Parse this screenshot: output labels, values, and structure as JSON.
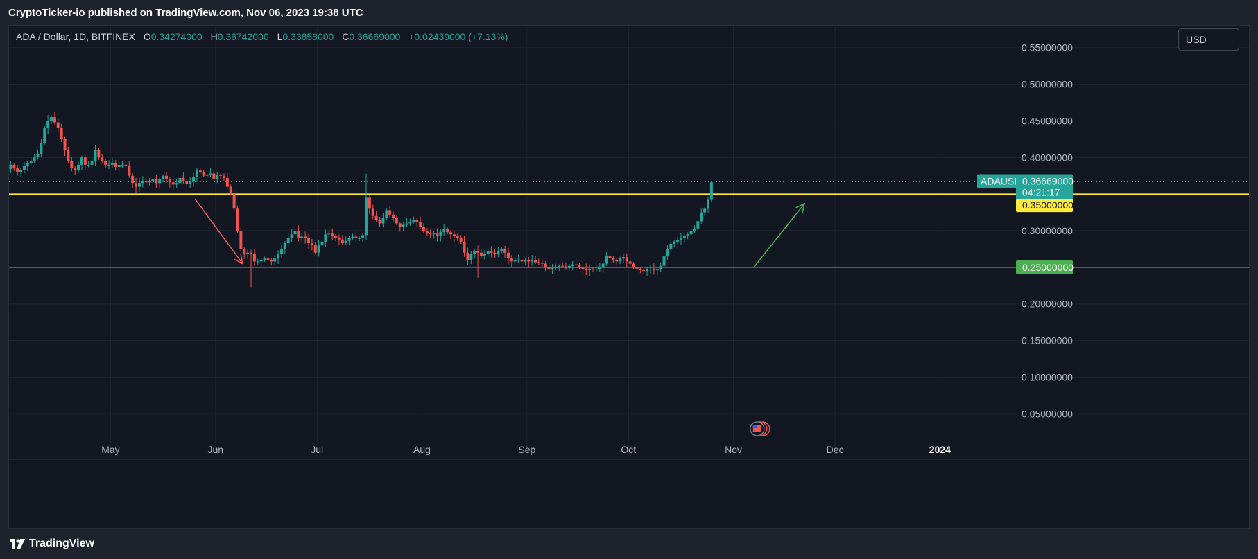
{
  "header": {
    "publisher": "CryptoTicker-io",
    "published_text": "published on TradingView.com, Nov 06, 2023 19:38 UTC"
  },
  "legend": {
    "symbol": "ADA / Dollar, 1D, BITFINEX",
    "open_label": "O",
    "open": "0.34274000",
    "high_label": "H",
    "high": "0.36742000",
    "low_label": "L",
    "low": "0.33858000",
    "close_label": "C",
    "close": "0.36669000",
    "change": "+0.02439000 (+7.13%)"
  },
  "currency_button": "USD",
  "footer": {
    "brand": "TradingView"
  },
  "colors": {
    "up": "#26a69a",
    "down": "#ef5350",
    "resistance": "#ffeb3b",
    "support": "#4caf50",
    "arrow_down": "#f05a5a",
    "arrow_up": "#4caf50"
  },
  "price_tags": {
    "symbol_tag": "ADAUSD",
    "last_price": "0.36669000",
    "countdown": "04:21:17",
    "resistance": "0.35000000",
    "support": "0.25000000"
  },
  "chart_data": {
    "type": "candlestick",
    "symbol": "ADAUSD",
    "timeframe": "1D",
    "exchange": "BITFINEX",
    "ylim": [
      0.02,
      0.58
    ],
    "y_ticks": [
      0.05,
      0.1,
      0.15,
      0.2,
      0.25,
      0.3,
      0.35,
      0.4,
      0.45,
      0.5,
      0.55
    ],
    "y_tick_labels": [
      "0.05000000",
      "0.10000000",
      "0.15000000",
      "0.20000000",
      "0.25000000",
      "0.30000000",
      "0.35000000",
      "0.40000000",
      "0.45000000",
      "0.50000000",
      "0.55000000"
    ],
    "x_start": "2023-04-01",
    "x_end": "2024-01-21",
    "x_ticks": [
      {
        "date": "2023-05-01",
        "label": "May"
      },
      {
        "date": "2023-06-01",
        "label": "Jun"
      },
      {
        "date": "2023-07-01",
        "label": "Jul"
      },
      {
        "date": "2023-08-01",
        "label": "Aug"
      },
      {
        "date": "2023-09-01",
        "label": "Sep"
      },
      {
        "date": "2023-10-01",
        "label": "Oct"
      },
      {
        "date": "2023-11-01",
        "label": "Nov"
      },
      {
        "date": "2023-12-01",
        "label": "Dec"
      },
      {
        "date": "2024-01-01",
        "label": "2024",
        "bold": true
      }
    ],
    "grid": true,
    "horizontal_lines": [
      {
        "value": 0.35,
        "color": "#ffeb3b",
        "name": "resistance"
      },
      {
        "value": 0.25,
        "color": "#4caf50",
        "name": "support"
      }
    ],
    "last_price": 0.36669,
    "arrows": [
      {
        "from": {
          "date": "2023-05-26",
          "value": 0.343
        },
        "to": {
          "date": "2023-06-09",
          "value": 0.255
        },
        "color": "#f05a5a"
      },
      {
        "from": {
          "date": "2023-11-07",
          "value": 0.25
        },
        "to": {
          "date": "2023-11-22",
          "value": 0.337
        },
        "color": "#4caf50"
      }
    ],
    "closes": [
      0.39,
      0.385,
      0.38,
      0.383,
      0.388,
      0.392,
      0.395,
      0.4,
      0.405,
      0.42,
      0.44,
      0.45,
      0.455,
      0.448,
      0.44,
      0.425,
      0.41,
      0.395,
      0.385,
      0.383,
      0.39,
      0.4,
      0.39,
      0.39,
      0.395,
      0.41,
      0.4,
      0.395,
      0.39,
      0.39,
      0.392,
      0.387,
      0.39,
      0.39,
      0.388,
      0.375,
      0.365,
      0.36,
      0.365,
      0.368,
      0.366,
      0.368,
      0.37,
      0.365,
      0.37,
      0.375,
      0.37,
      0.366,
      0.363,
      0.365,
      0.372,
      0.368,
      0.364,
      0.367,
      0.373,
      0.382,
      0.38,
      0.375,
      0.376,
      0.378,
      0.37,
      0.376,
      0.375,
      0.372,
      0.36,
      0.35,
      0.33,
      0.3,
      0.275,
      0.268,
      0.27,
      0.268,
      0.258,
      0.258,
      0.26,
      0.262,
      0.26,
      0.258,
      0.262,
      0.268,
      0.275,
      0.283,
      0.29,
      0.295,
      0.3,
      0.29,
      0.292,
      0.29,
      0.283,
      0.28,
      0.27,
      0.28,
      0.285,
      0.295,
      0.296,
      0.293,
      0.29,
      0.288,
      0.283,
      0.286,
      0.29,
      0.292,
      0.29,
      0.29,
      0.294,
      0.345,
      0.33,
      0.32,
      0.315,
      0.31,
      0.317,
      0.328,
      0.322,
      0.317,
      0.31,
      0.305,
      0.308,
      0.31,
      0.312,
      0.315,
      0.312,
      0.305,
      0.3,
      0.296,
      0.295,
      0.296,
      0.293,
      0.298,
      0.302,
      0.298,
      0.295,
      0.293,
      0.29,
      0.285,
      0.27,
      0.26,
      0.268,
      0.272,
      0.27,
      0.266,
      0.268,
      0.272,
      0.27,
      0.268,
      0.272,
      0.275,
      0.27,
      0.262,
      0.258,
      0.26,
      0.26,
      0.258,
      0.26,
      0.258,
      0.26,
      0.257,
      0.256,
      0.255,
      0.25,
      0.247,
      0.249,
      0.25,
      0.252,
      0.251,
      0.249,
      0.252,
      0.254,
      0.253,
      0.25,
      0.248,
      0.246,
      0.248,
      0.247,
      0.248,
      0.25,
      0.255,
      0.265,
      0.263,
      0.26,
      0.258,
      0.262,
      0.264,
      0.258,
      0.255,
      0.25,
      0.248,
      0.246,
      0.245,
      0.247,
      0.248,
      0.246,
      0.247,
      0.252,
      0.265,
      0.275,
      0.282,
      0.285,
      0.287,
      0.29,
      0.293,
      0.295,
      0.3,
      0.303,
      0.313,
      0.325,
      0.33,
      0.342,
      0.366
    ],
    "notes": "closes are approximate daily closes from 2023-04-01 to 2023-11-06; open of each candle equals previous close"
  }
}
